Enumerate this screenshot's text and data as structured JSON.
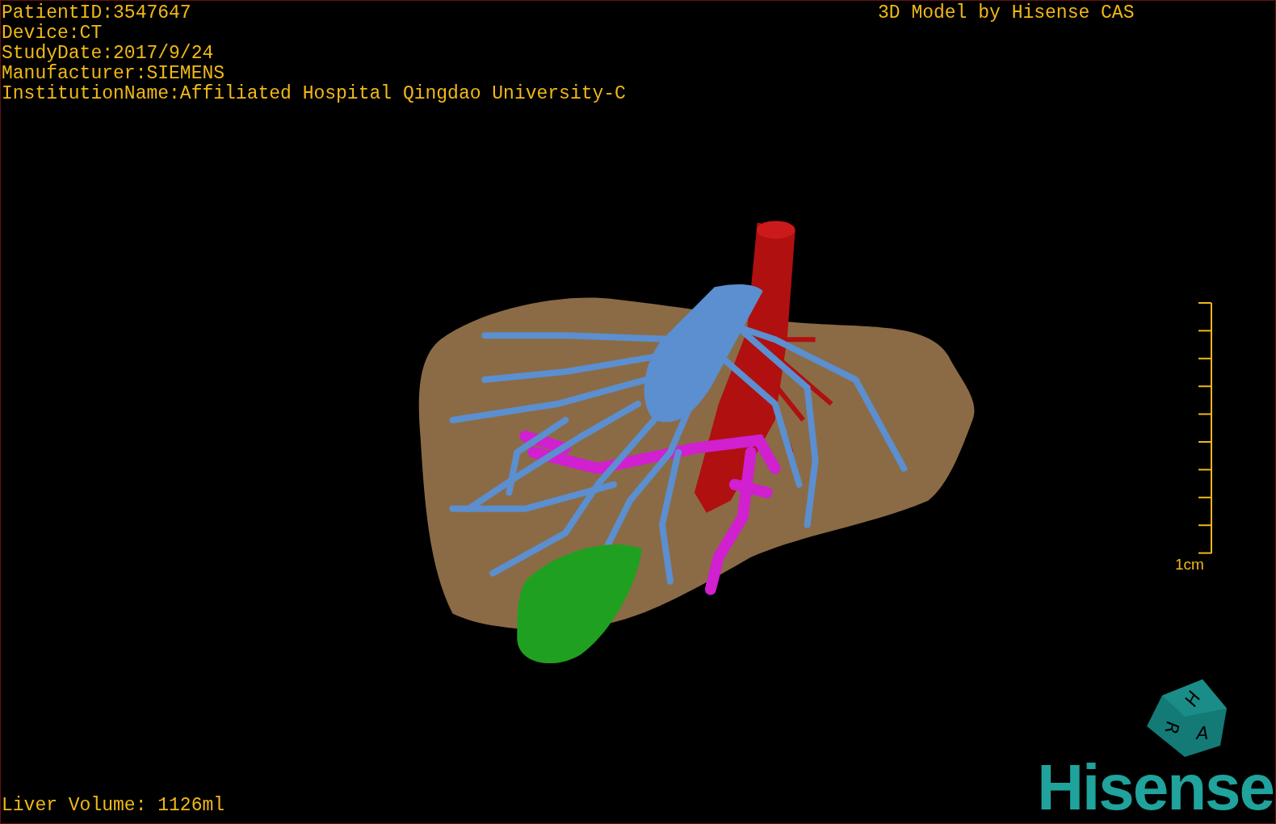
{
  "info_lines": [
    "PatientID:3547647",
    "Device:CT",
    "StudyDate:2017/9/24",
    "Manufacturer:SIEMENS",
    "InstitutionName:Affiliated Hospital Qingdao University-C"
  ],
  "title": "3D Model by Hisense CAS",
  "scale_bar": {
    "label": "1cm"
  },
  "liver_volume": "Liver Volume: 1126ml",
  "orientation_cube": {
    "faces": [
      "H",
      "R",
      "A"
    ]
  },
  "logo": {
    "text": "Hisense"
  }
}
